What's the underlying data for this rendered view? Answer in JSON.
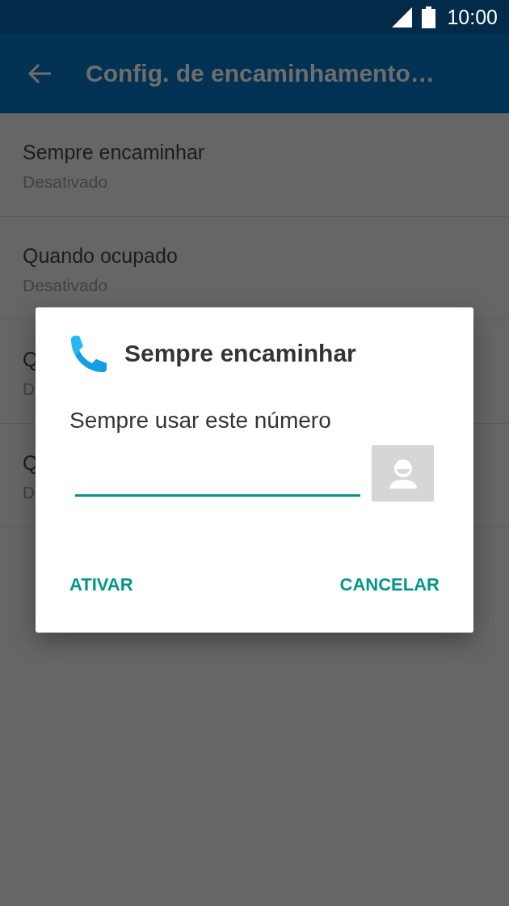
{
  "status_bar": {
    "time": "10:00"
  },
  "app_bar": {
    "title": "Config. de encaminhamento…"
  },
  "settings": [
    {
      "title": "Sempre encaminhar",
      "summary": "Desativado"
    },
    {
      "title": "Quando ocupado",
      "summary": "Desativado"
    },
    {
      "title": "Q",
      "summary": "D"
    },
    {
      "title": "Q",
      "summary": "D"
    }
  ],
  "dialog": {
    "title": "Sempre encaminhar",
    "message": "Sempre usar este número",
    "buttons": [
      {
        "label": "ATIVAR"
      },
      {
        "label": "CANCELAR"
      }
    ]
  }
}
